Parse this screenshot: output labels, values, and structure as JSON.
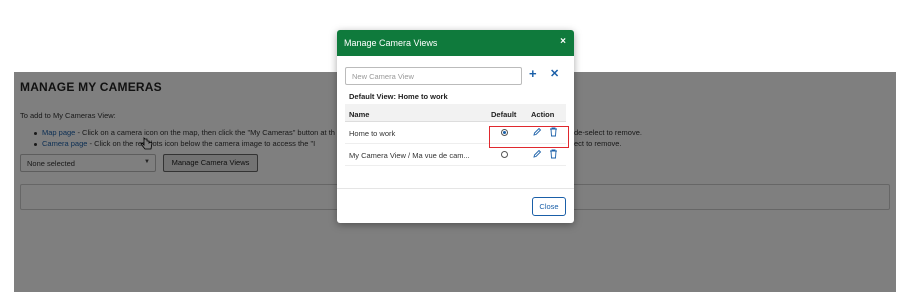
{
  "page": {
    "title": "MANAGE MY CAMERAS",
    "intro": "To add to My Cameras View:",
    "bullets": [
      {
        "link": "Map page",
        "text": " - Click on a camera icon on the map, then click the \"My Cameras\" button at th",
        "tail": "de-select to remove."
      },
      {
        "link": "Camera page",
        "text": " - Click on the      ree dots icon below the camera image to access the \"I",
        "tail": "ect to remove."
      }
    ],
    "select_value": "None selected",
    "manage_button": "Manage Camera Views"
  },
  "modal": {
    "title": "Manage Camera Views",
    "close_glyph": "×",
    "input_placeholder": "New Camera View",
    "add_glyph": "+",
    "cancel_glyph": "✕",
    "default_view_label": "Default View: Home to work",
    "columns": {
      "name": "Name",
      "default": "Default",
      "action": "Action"
    },
    "rows": [
      {
        "name": "Home to work",
        "default": true
      },
      {
        "name": "My Camera View / Ma vue de cam...",
        "default": false
      }
    ],
    "close_button": "Close"
  },
  "colors": {
    "header": "#0f7a3c",
    "accent": "#1a5fa8",
    "highlight": "#e0282e"
  }
}
